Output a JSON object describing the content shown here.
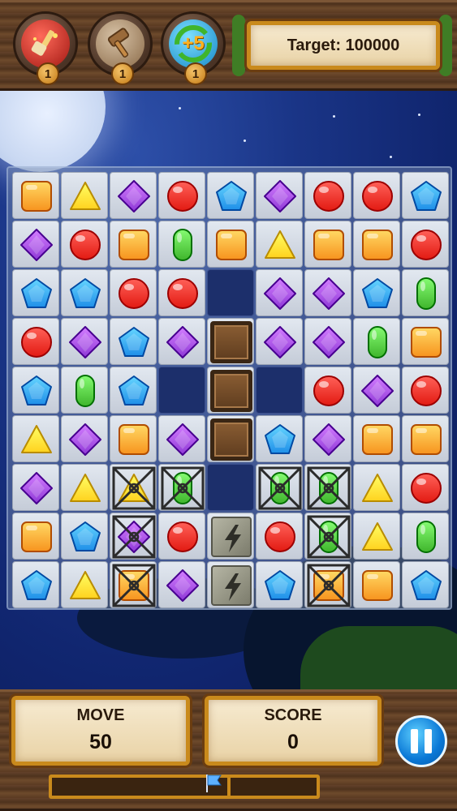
{
  "boosters": [
    {
      "name": "brush",
      "icon": "paintbrush-icon",
      "count": "1",
      "color": "#c8302a"
    },
    {
      "name": "hammer",
      "icon": "hammer-icon",
      "count": "1",
      "color": "#8a6a48"
    },
    {
      "name": "plus-five",
      "icon": "plus-five-moves-icon",
      "label": "+5",
      "count": "1",
      "color": "#3a9a3a"
    }
  ],
  "target": {
    "text": "Target: 100000"
  },
  "board": {
    "rows": 9,
    "cols": 9,
    "gems": [
      [
        "O",
        "Y",
        "P",
        "R",
        "B",
        "P",
        "R",
        "R",
        "B"
      ],
      [
        "P",
        "R",
        "O",
        "G",
        "O",
        "Y",
        "O",
        "O",
        "R"
      ],
      [
        "B",
        "B",
        "R",
        "R",
        "-",
        "P",
        "P",
        "B",
        "G"
      ],
      [
        "R",
        "P",
        "B",
        "P",
        "X",
        "P",
        "P",
        "G",
        "O"
      ],
      [
        "B",
        "G",
        "B",
        "-",
        "X",
        "-",
        "R",
        "P",
        "R"
      ],
      [
        "Y",
        "P",
        "O",
        "P",
        "X",
        "B",
        "P",
        "O",
        "O"
      ],
      [
        "P",
        "Y",
        "Y",
        "G",
        "-",
        "G",
        "G",
        "Y",
        "R"
      ],
      [
        "O",
        "B",
        "P",
        "R",
        "S",
        "R",
        "G",
        "Y",
        "G"
      ],
      [
        "B",
        "Y",
        "O",
        "P",
        "S",
        "B",
        "O",
        "O",
        "B"
      ]
    ],
    "cages": [
      [
        6,
        2
      ],
      [
        6,
        3
      ],
      [
        6,
        5
      ],
      [
        6,
        6
      ],
      [
        7,
        2
      ],
      [
        7,
        6
      ],
      [
        8,
        2
      ],
      [
        8,
        6
      ]
    ],
    "legend": {
      "R": "red-round-gem",
      "O": "orange-square-gem",
      "Y": "yellow-triangle-gem",
      "P": "purple-diamond-gem",
      "B": "blue-pentagon-gem",
      "G": "green-oval-gem",
      "X": "wooden-crate",
      "S": "lightning-stone-block",
      "-": "empty"
    }
  },
  "colors": {
    "R": "#e21a12",
    "O": "#f7931e",
    "Y": "#ffd21f",
    "P": "#8e38d6",
    "B": "#1f8fe8",
    "G": "#3fb52c"
  },
  "moves": {
    "label": "MOVE",
    "value": "50"
  },
  "score": {
    "label": "SCORE",
    "value": "0"
  },
  "progress": {
    "fraction": 0.0
  }
}
